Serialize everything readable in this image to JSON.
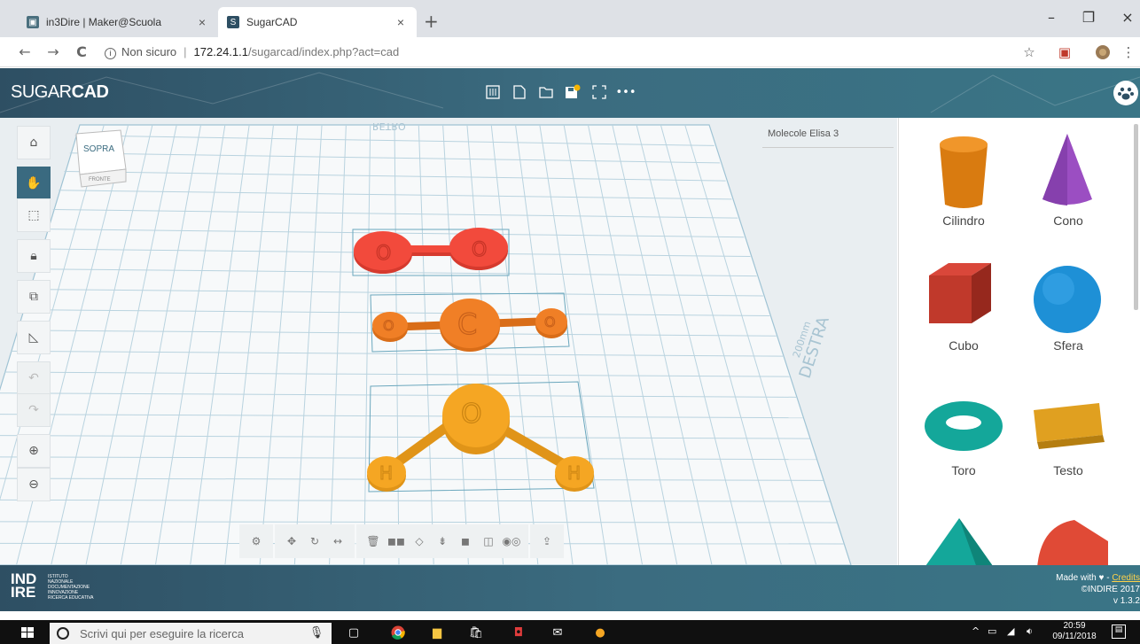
{
  "browser": {
    "tabs": [
      {
        "title": "in3Dire | Maker@Scuola",
        "close": "×"
      },
      {
        "title": "SugarCAD",
        "close": "×"
      }
    ],
    "new_tab": "+",
    "window_controls": {
      "minimize": "–",
      "restore": "❐",
      "close": "×"
    },
    "address": {
      "security": "Non sicuro",
      "host": "172.24.1.1",
      "path": "/sugarcad/index.php?act=cad"
    }
  },
  "app": {
    "logo_light": "SUGAR",
    "logo_bold": "CAD",
    "more_label": "•••",
    "project_name": "Molecole Elisa 3",
    "viewcube": {
      "top": "SOPRA",
      "front": "FRONTE"
    },
    "grid_labels": {
      "back": "RETRO",
      "right": "DESTRA",
      "size": "200mm"
    }
  },
  "molecules": [
    {
      "name": "O2",
      "color": "#f24a3c",
      "atoms": [
        "O",
        "O"
      ]
    },
    {
      "name": "CO2",
      "color": "#f07f26",
      "atoms": [
        "O",
        "C",
        "O"
      ]
    },
    {
      "name": "H2O",
      "color": "#f5a623",
      "atoms": [
        "O",
        "H",
        "H"
      ]
    }
  ],
  "shapes": [
    {
      "label": "Cilindro",
      "color": "#d97b10"
    },
    {
      "label": "Cono",
      "color": "#9b4ec2"
    },
    {
      "label": "Cubo",
      "color": "#c0392b"
    },
    {
      "label": "Sfera",
      "color": "#1e90d6"
    },
    {
      "label": "Toro",
      "color": "#14a79a"
    },
    {
      "label": "Testo",
      "color": "#e0a020"
    }
  ],
  "footer": {
    "logo_top": "IND",
    "logo_bottom": "IRE",
    "org_lines": [
      "ISTITUTO",
      "NAZIONALE",
      "DOCUMENTAZIONE",
      "INNOVAZIONE",
      "RICERCA EDUCATIVA"
    ],
    "made_with": "Made with",
    "credits": "Credits",
    "copyright": "©INDIRE 2017",
    "version": "v 1.3.2"
  },
  "taskbar": {
    "search_placeholder": "Scrivi qui per eseguire la ricerca",
    "time": "20:59",
    "date": "09/11/2018"
  }
}
